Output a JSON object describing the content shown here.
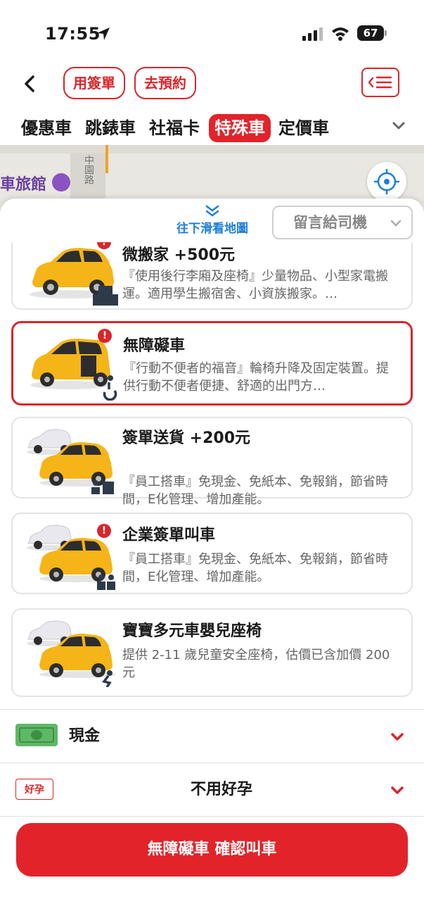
{
  "status_bar": {
    "time": "17:55",
    "battery": "67"
  },
  "header": {
    "sign_order_label": "用簽單",
    "reserve_label": "去預約"
  },
  "tabs": [
    {
      "label": "優惠車",
      "active": false
    },
    {
      "label": "跳錶車",
      "active": false
    },
    {
      "label": "社福卡",
      "active": false
    },
    {
      "label": "特殊車",
      "active": true
    },
    {
      "label": "定價車",
      "active": false
    }
  ],
  "map": {
    "poi_label": "車旅館",
    "street_label": "中園路"
  },
  "sheet": {
    "swipe_hint": "往下滑看地圖",
    "message_select": "留言給司機"
  },
  "services": [
    {
      "title": "微搬家 +500元",
      "desc": "『使用後行李廂及座椅』少量物品、小型家電搬運。適用學生搬宿舍、小資族搬家。…",
      "selected": false,
      "icon": "small-box-icon"
    },
    {
      "title": "無障礙車",
      "desc": "『行動不便者的福音』輪椅升降及固定裝置。提供行動不便者便捷、舒適的出門方…",
      "selected": true,
      "icon": "wheelchair-icon"
    },
    {
      "title": "簽單送貨 +200元",
      "desc": "『員工搭車』免現金、免紙本、免報銷，節省時間，E化管理、增加產能。",
      "selected": false,
      "icon": "delivery-person-icon"
    },
    {
      "title": "企業簽單叫車",
      "desc": "『員工搭車』免現金、免紙本、免報銷，節省時間，E化管理、增加產能。",
      "selected": false,
      "icon": "business-people-icon"
    },
    {
      "title": "寶寶多元車嬰兒座椅",
      "desc": "提供 2-11 歲兒童安全座椅，估價已含加價 200元",
      "selected": false,
      "icon": "child-seat-icon"
    }
  ],
  "payment": {
    "label": "現金"
  },
  "haoyun": {
    "badge": "好孕",
    "label": "不用好孕"
  },
  "cta": {
    "label": "無障礙車 確認叫車"
  },
  "colors": {
    "accent": "#e2232a",
    "link": "#1e7fd6",
    "taxi": "#f5b518"
  }
}
